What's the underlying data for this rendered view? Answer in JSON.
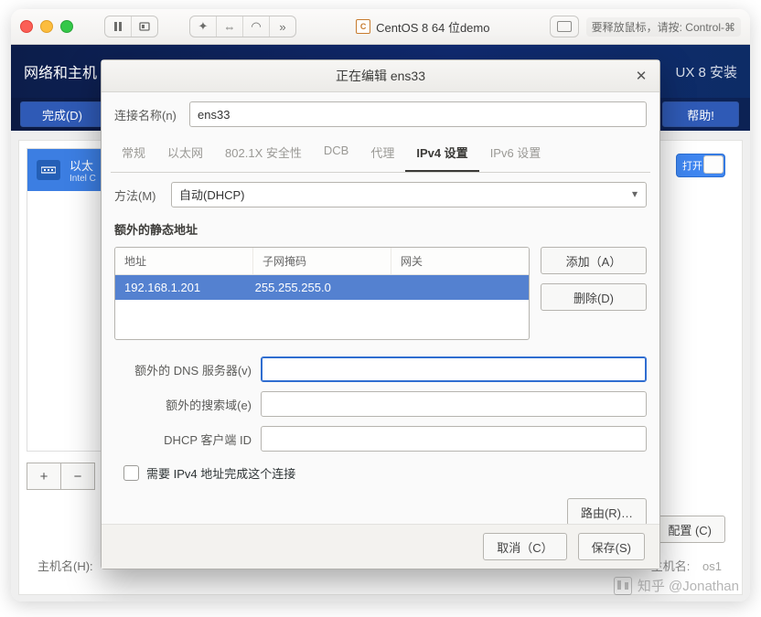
{
  "mac_toolbar": {
    "vm_title": "CentOS 8 64 位demo",
    "release_hint": "要释放鼠标，请按: Control-⌘"
  },
  "installer": {
    "banner_title": "网络和主机",
    "banner_right": "UX 8 安装",
    "done": "完成(D)",
    "help": "帮助!",
    "net_item": {
      "title": "以太",
      "subtitle": "Intel C"
    },
    "switch_label": "打开",
    "configure": "配置 (C)",
    "hostname_label": "主机名(H):",
    "hostname_right_label": "主机名:",
    "hostname_value": "os1"
  },
  "dialog": {
    "title": "正在编辑 ens33",
    "conn_name_label": "连接名称(n)",
    "conn_name_value": "ens33",
    "tabs": [
      "常规",
      "以太网",
      "802.1X 安全性",
      "DCB",
      "代理",
      "IPv4 设置",
      "IPv6 设置"
    ],
    "active_tab_index": 5,
    "method_label": "方法(M)",
    "method_value": "自动(DHCP)",
    "extra_static_title": "额外的静态地址",
    "table_headers": [
      "地址",
      "子网掩码",
      "网关"
    ],
    "table_row": {
      "address": "192.168.1.201",
      "mask": "255.255.255.0",
      "gateway": ""
    },
    "add_btn": "添加（A）",
    "del_btn": "删除(D)",
    "dns_label": "额外的 DNS 服务器(v)",
    "search_label": "额外的搜索域(e)",
    "dhcp_client_label": "DHCP 客户端 ID",
    "require_ipv4": "需要 IPv4 地址完成这个连接",
    "routes_btn": "路由(R)…",
    "cancel": "取消（C）",
    "save": "保存(S)"
  },
  "watermark": "知乎 @Jonathan"
}
